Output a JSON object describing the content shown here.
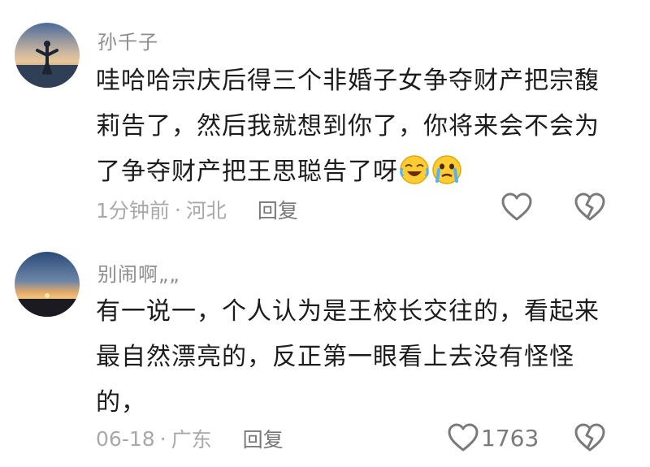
{
  "comments": [
    {
      "username": "孙千子",
      "text": "哇哈哈宗庆后得三个非婚子女争夺财产把宗馥莉告了，然后我就想到你了，你将来会不会为了争夺财产把王思聪告了呀",
      "emojis": [
        "laughing-crying-emoji",
        "crying-emoji"
      ],
      "time": "1分钟前",
      "location": "河北",
      "separator": "·",
      "reply_label": "回复",
      "like_count": ""
    },
    {
      "username": "别闹啊„„",
      "text": "有一说一，个人认为是王校长交往的，看起来最自然漂亮的，反正第一眼看上去没有怪怪的，",
      "emojis": [],
      "time": "06-18",
      "location": "广东",
      "separator": "·",
      "reply_label": "回复",
      "like_count": "1763"
    }
  ],
  "icons": {
    "like": "heart-outline-icon",
    "dislike": "broken-heart-outline-icon"
  },
  "colors": {
    "username": "#8d8d8d",
    "meta": "#a9a9a9",
    "reply": "#777777",
    "icon": "#7a7a7a"
  }
}
